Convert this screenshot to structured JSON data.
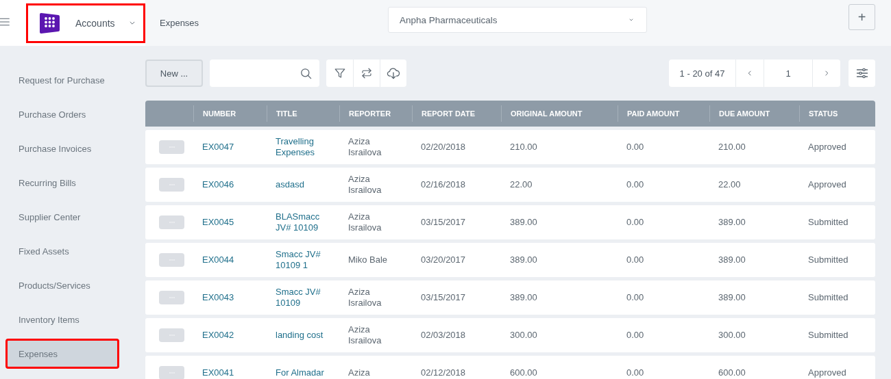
{
  "header": {
    "app_menu": {
      "label": "Accounts",
      "highlighted": true
    },
    "breadcrumb": "Expenses",
    "company": {
      "value": "Anpha Pharmaceuticals"
    },
    "add_button": "+"
  },
  "sidebar": {
    "items": [
      {
        "label": "Request for Purchase",
        "selected": false,
        "highlighted": false
      },
      {
        "label": "Purchase Orders",
        "selected": false,
        "highlighted": false
      },
      {
        "label": "Purchase Invoices",
        "selected": false,
        "highlighted": false
      },
      {
        "label": "Recurring Bills",
        "selected": false,
        "highlighted": false
      },
      {
        "label": "Supplier Center",
        "selected": false,
        "highlighted": false
      },
      {
        "label": "Fixed Assets",
        "selected": false,
        "highlighted": false
      },
      {
        "label": "Products/Services",
        "selected": false,
        "highlighted": false
      },
      {
        "label": "Inventory Items",
        "selected": false,
        "highlighted": false
      },
      {
        "label": "Expenses",
        "selected": true,
        "highlighted": true
      }
    ]
  },
  "toolbar": {
    "new_button": "New ...",
    "pagination": {
      "range": "1 - 20 of 47",
      "page": "1"
    }
  },
  "table": {
    "columns": [
      "NUMBER",
      "TITLE",
      "REPORTER",
      "REPORT DATE",
      "ORIGINAL AMOUNT",
      "PAID AMOUNT",
      "DUE AMOUNT",
      "STATUS"
    ],
    "rows": [
      {
        "number": "EX0047",
        "title": "Travelling Expenses",
        "reporter": "Aziza Israilova",
        "date": "02/20/2018",
        "original": "210.00",
        "paid": "0.00",
        "due": "210.00",
        "status": "Approved"
      },
      {
        "number": "EX0046",
        "title": "asdasd",
        "reporter": "Aziza Israilova",
        "date": "02/16/2018",
        "original": "22.00",
        "paid": "0.00",
        "due": "22.00",
        "status": "Approved"
      },
      {
        "number": "EX0045",
        "title": "BLASmacc JV# 10109",
        "reporter": "Aziza Israilova",
        "date": "03/15/2017",
        "original": "389.00",
        "paid": "0.00",
        "due": "389.00",
        "status": "Submitted"
      },
      {
        "number": "EX0044",
        "title": "Smacc JV# 10109 1",
        "reporter": "Miko Bale",
        "date": "03/20/2017",
        "original": "389.00",
        "paid": "0.00",
        "due": "389.00",
        "status": "Submitted"
      },
      {
        "number": "EX0043",
        "title": "Smacc JV# 10109",
        "reporter": "Aziza Israilova",
        "date": "03/15/2017",
        "original": "389.00",
        "paid": "0.00",
        "due": "389.00",
        "status": "Submitted"
      },
      {
        "number": "EX0042",
        "title": "landing cost",
        "reporter": "Aziza Israilova",
        "date": "02/03/2018",
        "original": "300.00",
        "paid": "0.00",
        "due": "300.00",
        "status": "Submitted"
      },
      {
        "number": "EX0041",
        "title": "For Almadar",
        "reporter": "Aziza",
        "date": "02/12/2018",
        "original": "600.00",
        "paid": "0.00",
        "due": "600.00",
        "status": "Approved"
      }
    ]
  }
}
